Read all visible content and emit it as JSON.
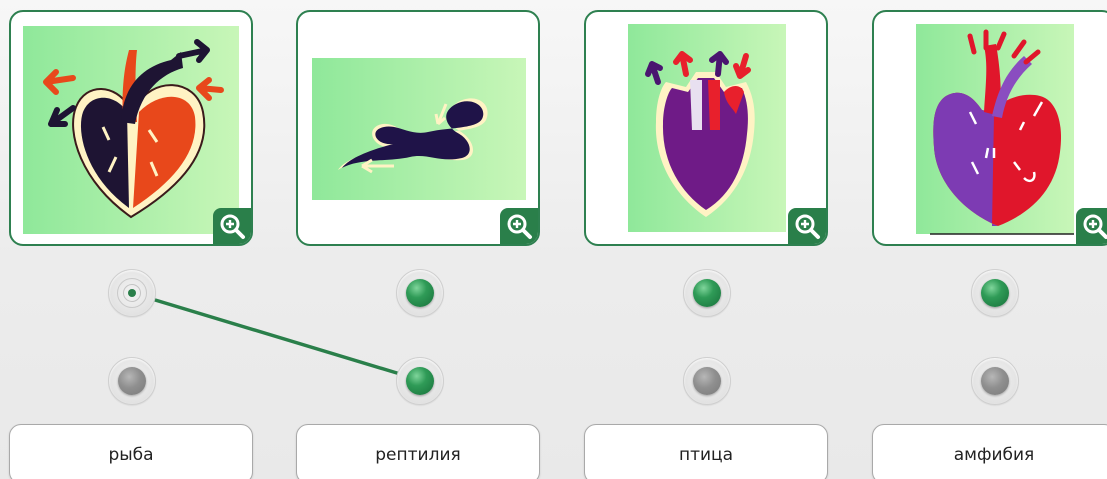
{
  "cards": [
    {
      "image": "fish-heart-diagram",
      "zoom_icon": "zoom-in-icon"
    },
    {
      "image": "reptile-heart-diagram",
      "zoom_icon": "zoom-in-icon"
    },
    {
      "image": "bird-heart-diagram",
      "zoom_icon": "zoom-in-icon"
    },
    {
      "image": "amphibian-heart-diagram",
      "zoom_icon": "zoom-in-icon"
    }
  ],
  "top_dots": [
    {
      "state": "selected"
    },
    {
      "state": "green"
    },
    {
      "state": "green"
    },
    {
      "state": "green"
    }
  ],
  "bottom_dots": [
    {
      "state": "gray"
    },
    {
      "state": "green"
    },
    {
      "state": "gray"
    },
    {
      "state": "gray"
    }
  ],
  "labels": [
    "рыба",
    "рептилия",
    "птица",
    "амфибия"
  ],
  "connections": [
    {
      "from_top": 1,
      "to_bottom": 2
    }
  ],
  "colors": {
    "accent_green": "#2a7f4a",
    "card_border": "#2e8050",
    "image_bg_green": "#98ec98"
  }
}
